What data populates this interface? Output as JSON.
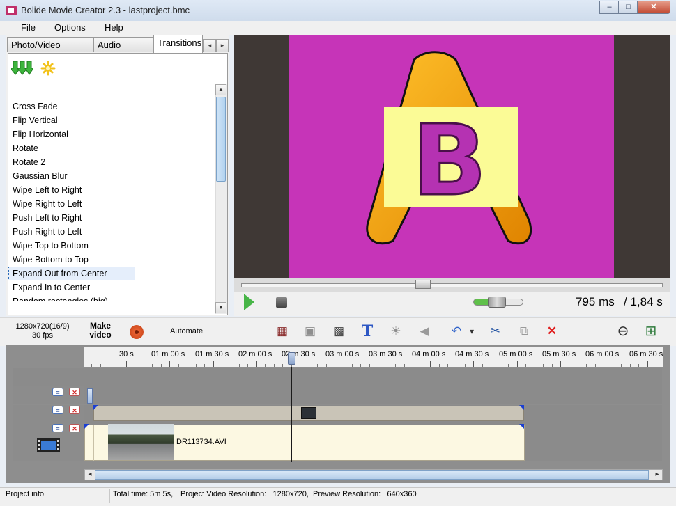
{
  "window": {
    "title": "Bolide Movie Creator 2.3 - lastproject.bmc",
    "minimize": "–",
    "restore": "□",
    "close": "✕"
  },
  "menu": {
    "items": [
      "File",
      "Options",
      "Help"
    ]
  },
  "tabs": {
    "photo_video": "Photo/Video Library",
    "audio": "Audio Library",
    "transitions": "Transitions",
    "left_arrow": "◂",
    "right_arrow": "▸"
  },
  "library": {
    "import_icon": "green-down-arrows-icon",
    "new_icon": "sparkle-icon",
    "items": [
      "Cross Fade",
      "Flip Vertical",
      "Flip Horizontal",
      "Rotate",
      "Rotate 2",
      "Gaussian Blur",
      "Wipe Left to Right",
      "Wipe Right to Left",
      "Push Left to Right",
      "Push Right to Left",
      "Wipe Top to Bottom",
      "Wipe Bottom to Top",
      "Expand Out from Center",
      "Expand In to Center",
      "Random rectangles (big)"
    ],
    "selected_index": 12,
    "scroll_up": "▲",
    "scroll_down": "▼"
  },
  "preview": {
    "background_color": "#c634b8",
    "letter_big": "A",
    "letter_card": "B",
    "time_current": "795 ms",
    "time_total": "/ 1,84 s",
    "volume_percent": 45
  },
  "toolbar": {
    "resolution": "1280x720(16/9)",
    "fps": "30 fps",
    "make_video_line1": "Make",
    "make_video_line2": "video",
    "automate": "Automate",
    "tools": {
      "add_clip": "▦",
      "resize": "▣",
      "photo": "▩",
      "text": "T",
      "brightness": "☀",
      "volume": "◀",
      "undo": "↶",
      "undo_dropdown": "▾",
      "cut": "✂",
      "paste": "⧉",
      "delete": "✕",
      "zoom_out": "⊖",
      "zoom_fit": "⊞"
    }
  },
  "timeline": {
    "ruler_labels": [
      "30 s",
      "01 m 00 s",
      "01 m 30 s",
      "02 m 00 s",
      "02 m 30 s",
      "03 m 00 s",
      "03 m 30 s",
      "04 m 00 s",
      "04 m 30 s",
      "05 m 00 s",
      "05 m 30 s",
      "06 m 00 s",
      "06 m 30 s"
    ],
    "expand_symbol": "≡",
    "delete_symbol": "✕",
    "clip_name": "DR113734.AVI",
    "scroll_left": "◂",
    "scroll_right": "▸"
  },
  "status": {
    "project_info": "Project info",
    "total_time": "Total time: 5m 5s,",
    "project_resolution": "Project Video Resolution:   1280x720,",
    "preview_resolution": "Preview Resolution:   640x360"
  }
}
